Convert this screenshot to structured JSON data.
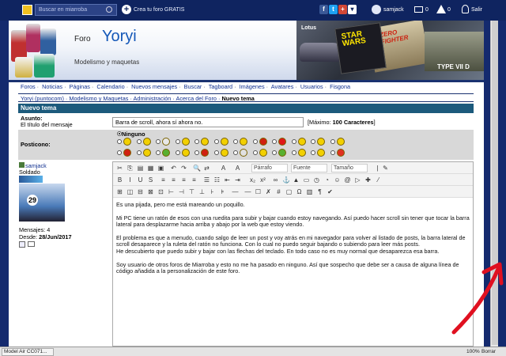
{
  "topbar": {
    "search_placeholder": "Buscar en miarroba",
    "create_forum": "Crea tu foro GRATIS",
    "user": "samjack",
    "messages_count": "0",
    "alerts_count": "0",
    "exit_label": "Salir",
    "social": [
      "f",
      "t",
      "+"
    ]
  },
  "header": {
    "foro_label": "Foro",
    "forum_name": "Yoryi",
    "subtitle": "Modelismo y maquetas",
    "banner_texts": [
      "Lotus",
      "STAR WARS",
      "ZERO FIGHTER",
      "TYPE VII D"
    ]
  },
  "nav": {
    "items": [
      "Foros",
      "Noticias",
      "Páginas",
      "Calendario",
      "Nuevos mensajes",
      "Buscar",
      "Tagboard",
      "Imágenes",
      "Avatares",
      "Usuarios",
      "Fisgona"
    ],
    "breadcrumb": [
      "Yoryi (puntocom)",
      "Modelismo y Maquetas",
      "Administración",
      "Acerca del Foro"
    ],
    "current": "Nuevo tema"
  },
  "form": {
    "header": "Nuevo tema",
    "subject_label": "Asunto:",
    "subject_hint": "El título del mensaje",
    "subject_value": "Barra de scroll, ahora sí ahora no.",
    "max_prefix": "[Máximo: ",
    "max_value": "100 Caracteres",
    "max_suffix": "]",
    "posticono_label": "Posticono:",
    "ninguno_label": "Ninguno",
    "smiley_colors": [
      "#f2d000",
      "#f2d000",
      "#e8e8e8",
      "#f2d000",
      "#f2d000",
      "#f2d000",
      "#f2d000",
      "#d02010",
      "#e01818",
      "#f2d000",
      "#f2d000",
      "#f2d000",
      "#d02010",
      "#f2d000",
      "#58b030",
      "#f2d000",
      "#d02010",
      "#f2d000",
      "#e0e0e0",
      "#f2d000",
      "#58b030",
      "#f2d000",
      "#f2d000",
      "#e03020"
    ]
  },
  "user": {
    "name": "samjack",
    "rank": "Soldado",
    "avatar_number": "29",
    "messages": "Mensajes: 4",
    "since_label": "Desde: ",
    "since_value": "28/Jun/2017"
  },
  "editor": {
    "font_family_select": "Párrafo",
    "font_select": "Fuente",
    "size_select": "Tamaño",
    "paragraphs": [
      "Es una pijada, pero me está mareando un poquillo.",
      "Mi PC tiene un ratón de esos con una ruedita para subir y bajar cuando estoy navegando. Así puedo hacer scroll sin tener que tocar la barra lateral para desplazarme hacia arriba y abajo por la web que estoy viendo.",
      "El problema es que a menudo, cuando salgo de leer un post y voy atrás en mi navegador para volver al listado de posts, la barra lateral de scroll desaparece y la ruleta del ratón no funciona. Con lo cual no puedo seguir bajando o subiendo para leer más posts.\nHe descubierto que puedo subir y bajar con las flechas del teclado. En todo caso no es muy normal que desaparezca esa barra.",
      "Soy usuario de otros foros de Miarroba y esto no me ha pasado en ninguno. Así que sospecho que debe ser a causa de alguna línea de código añadida a la personalización de este foro."
    ]
  },
  "statusbar": {
    "download_tab": "Model Air CC071...",
    "zoom": "100%",
    "borrar": "Borrar"
  },
  "colors": {
    "topbar": "#0f2460",
    "table_header": "#1c5a7c",
    "link": "#103090",
    "annotation_arrow": "#e01020"
  }
}
